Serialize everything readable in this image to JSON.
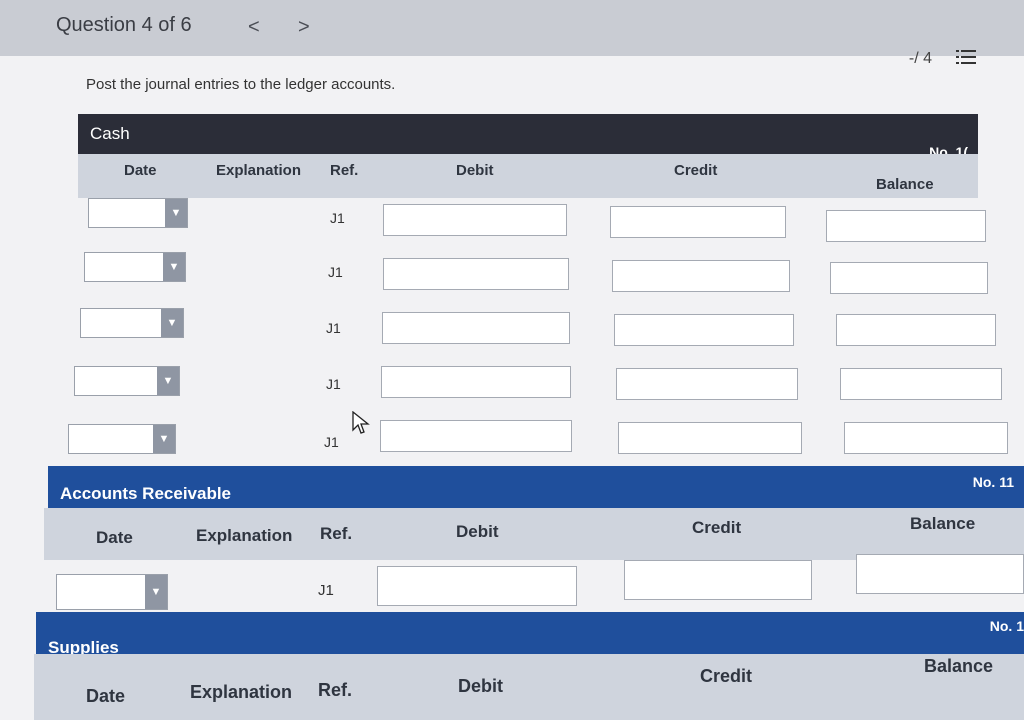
{
  "header": {
    "question_title": "Question 4 of 6",
    "prev_label": "<",
    "next_label": ">",
    "score": "-/ 4",
    "list_icon": "list-icon"
  },
  "instruction": "Post the journal entries to the ledger accounts.",
  "columns": {
    "date": "Date",
    "explanation": "Explanation",
    "ref": "Ref.",
    "debit": "Debit",
    "credit": "Credit",
    "balance": "Balance"
  },
  "accounts": [
    {
      "name": "Cash",
      "number": "No. 1(",
      "rows": [
        {
          "ref": "J1",
          "debit": "",
          "credit": "",
          "balance": ""
        },
        {
          "ref": "J1",
          "debit": "",
          "credit": "",
          "balance": ""
        },
        {
          "ref": "J1",
          "debit": "",
          "credit": "",
          "balance": ""
        },
        {
          "ref": "J1",
          "debit": "",
          "credit": "",
          "balance": ""
        },
        {
          "ref": "J1",
          "debit": "",
          "credit": "",
          "balance": ""
        }
      ]
    },
    {
      "name": "Accounts Receivable",
      "number": "No. 11",
      "rows": [
        {
          "ref": "J1",
          "debit": "",
          "credit": "",
          "balance": ""
        }
      ]
    },
    {
      "name": "Supplies",
      "number": "No. 1",
      "rows": []
    }
  ],
  "colors": {
    "cash_header": "#2b2d38",
    "ledger_header": "#1f4f9c",
    "column_header": "#cfd4dd"
  }
}
